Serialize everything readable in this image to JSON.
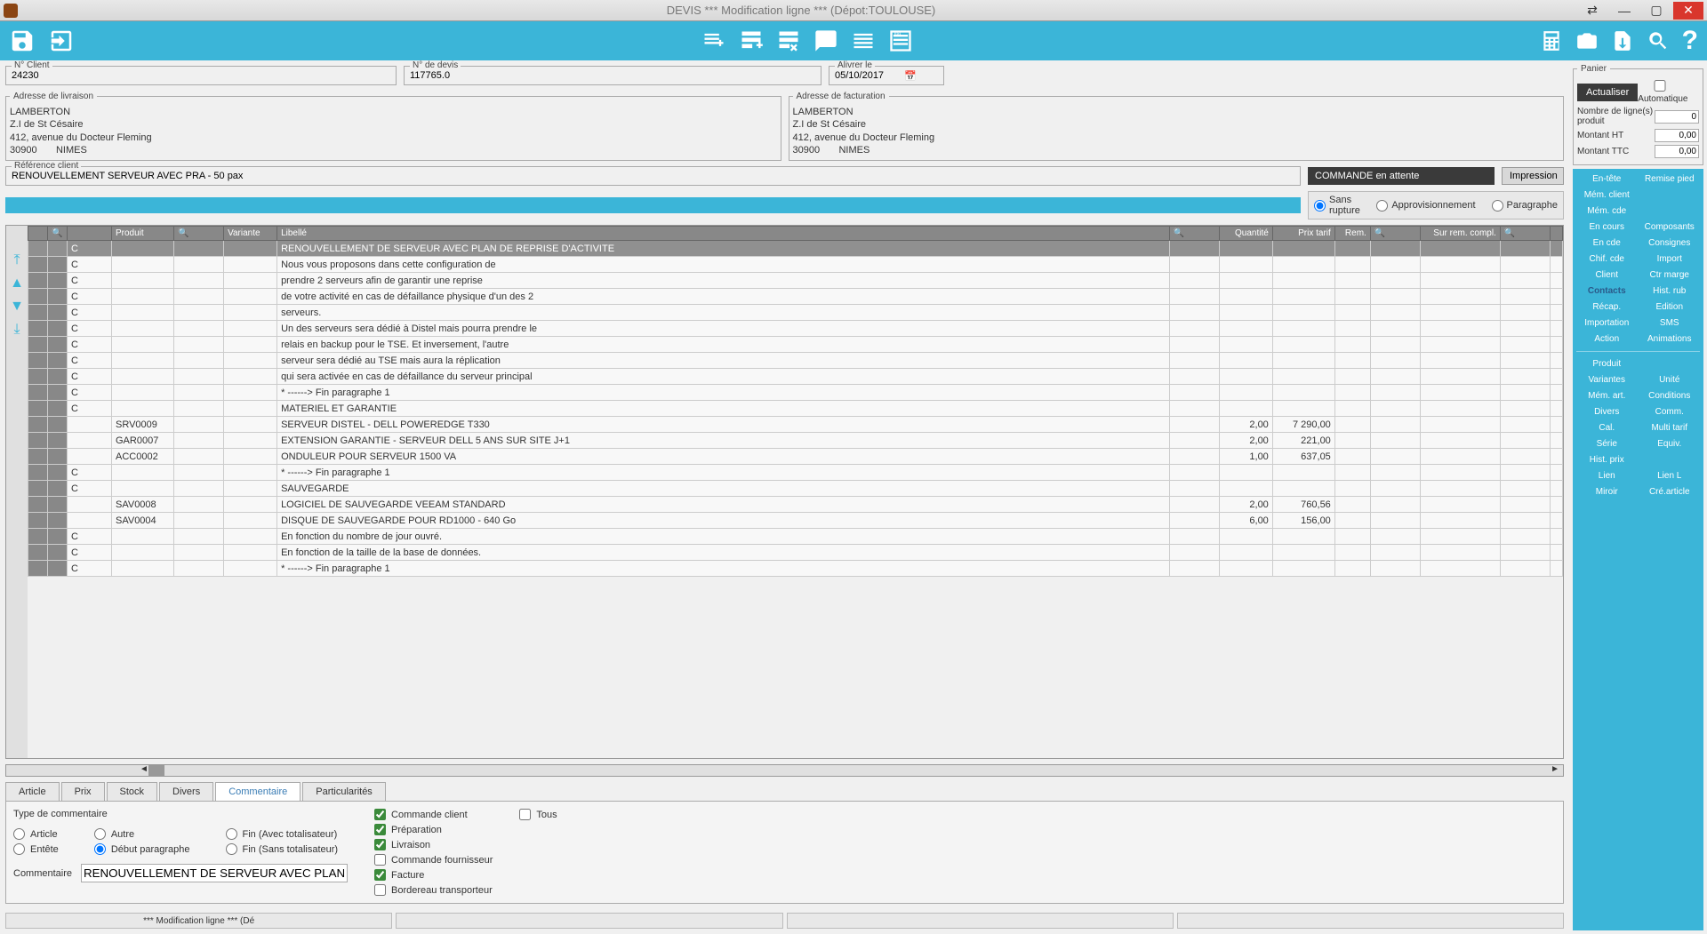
{
  "window": {
    "title": "DEVIS *** Modification ligne *** (Dépot:TOULOUSE)"
  },
  "toolbar": {},
  "fields": {
    "client_no_label": "N° Client",
    "client_no": "24230",
    "devis_no_label": "N° de devis",
    "devis_no": "117765.0",
    "alivrer_label": "Alivrer le",
    "alivrer": "05/10/2017",
    "ref_client_label": "Référence client",
    "ref_client": "RENOUVELLEMENT SERVEUR AVEC PRA - 50 pax"
  },
  "addr_livr": {
    "legend": "Adresse de livraison",
    "l1": "LAMBERTON",
    "l2": "Z.I de St Césaire",
    "l3": "412, avenue du Docteur Fleming",
    "l4": "30900       NIMES"
  },
  "addr_fact": {
    "legend": "Adresse de facturation",
    "l1": "LAMBERTON",
    "l2": "Z.I de St Césaire",
    "l3": "412, avenue du Docteur Fleming",
    "l4": "30900       NIMES"
  },
  "commande_attente": "COMMANDE en attente",
  "impression": "Impression",
  "rupture": {
    "sans": "Sans rupture",
    "appro": "Approvisionnement",
    "para": "Paragraphe"
  },
  "cols": {
    "produit": "Produit",
    "variante": "Variante",
    "libelle": "Libellé",
    "qte": "Quantité",
    "prix": "Prix tarif",
    "rem": "Rem.",
    "sur": "Sur rem. compl."
  },
  "rows": [
    {
      "t": "C",
      "p": "",
      "lib": "RENOUVELLEMENT DE SERVEUR AVEC PLAN DE REPRISE D'ACTIVITE",
      "q": "",
      "px": "",
      "hl": true
    },
    {
      "t": "C",
      "p": "",
      "lib": "Nous vous proposons dans cette configuration de",
      "q": "",
      "px": ""
    },
    {
      "t": "C",
      "p": "",
      "lib": "prendre 2 serveurs afin de garantir une reprise",
      "q": "",
      "px": ""
    },
    {
      "t": "C",
      "p": "",
      "lib": "de votre activité en cas de défaillance physique d'un des 2",
      "q": "",
      "px": ""
    },
    {
      "t": "C",
      "p": "",
      "lib": "serveurs.",
      "q": "",
      "px": ""
    },
    {
      "t": "C",
      "p": "",
      "lib": "Un des serveurs sera dédié à Distel mais pourra prendre le",
      "q": "",
      "px": ""
    },
    {
      "t": "C",
      "p": "",
      "lib": "relais en backup pour le TSE. Et inversement, l'autre",
      "q": "",
      "px": ""
    },
    {
      "t": "C",
      "p": "",
      "lib": "serveur sera dédié au TSE mais aura la réplication",
      "q": "",
      "px": ""
    },
    {
      "t": "C",
      "p": "",
      "lib": "qui sera activée en cas de défaillance du serveur principal",
      "q": "",
      "px": ""
    },
    {
      "t": "C",
      "p": "",
      "lib": "* ------> Fin paragraphe    1",
      "q": "",
      "px": ""
    },
    {
      "t": "C",
      "p": "",
      "lib": "MATERIEL ET GARANTIE",
      "q": "",
      "px": ""
    },
    {
      "t": "",
      "p": "SRV0009",
      "lib": "SERVEUR DISTEL - DELL POWEREDGE T330",
      "q": "2,00",
      "px": "7 290,00"
    },
    {
      "t": "",
      "p": "GAR0007",
      "lib": "EXTENSION GARANTIE - SERVEUR DELL 5 ANS SUR SITE J+1",
      "q": "2,00",
      "px": "221,00"
    },
    {
      "t": "",
      "p": "ACC0002",
      "lib": "ONDULEUR POUR SERVEUR 1500 VA",
      "q": "1,00",
      "px": "637,05"
    },
    {
      "t": "C",
      "p": "",
      "lib": "* ------> Fin paragraphe    1",
      "q": "",
      "px": ""
    },
    {
      "t": "C",
      "p": "",
      "lib": "SAUVEGARDE",
      "q": "",
      "px": ""
    },
    {
      "t": "",
      "p": "SAV0008",
      "lib": "LOGICIEL DE SAUVEGARDE VEEAM STANDARD",
      "q": "2,00",
      "px": "760,56"
    },
    {
      "t": "",
      "p": "SAV0004",
      "lib": "DISQUE DE SAUVEGARDE POUR RD1000 - 640 Go",
      "q": "6,00",
      "px": "156,00"
    },
    {
      "t": "C",
      "p": "",
      "lib": "En fonction du nombre de jour ouvré.",
      "q": "",
      "px": ""
    },
    {
      "t": "C",
      "p": "",
      "lib": "En fonction de la taille de la base de données.",
      "q": "",
      "px": ""
    },
    {
      "t": "C",
      "p": "",
      "lib": "* ------> Fin paragraphe    1",
      "q": "",
      "px": ""
    }
  ],
  "tabs": {
    "article": "Article",
    "prix": "Prix",
    "stock": "Stock",
    "divers": "Divers",
    "commentaire": "Commentaire",
    "partic": "Particularités"
  },
  "comment": {
    "type_label": "Type de commentaire",
    "article": "Article",
    "autre": "Autre",
    "fin_tot": "Fin (Avec totalisateur)",
    "entete": "Entête",
    "debut": "Début paragraphe",
    "fin_sans": "Fin (Sans totalisateur)",
    "commentaire_label": "Commentaire",
    "commentaire_val": "RENOUVELLEMENT DE SERVEUR AVEC PLAN DE REPRISE D'ACTIVITE",
    "cmd_client": "Commande client",
    "tous": "Tous",
    "prep": "Préparation",
    "livr": "Livraison",
    "cmd_fourn": "Commande fournisseur",
    "facture": "Facture",
    "bord": "Bordereau transporteur"
  },
  "status": "*** Modification ligne *** (Dé",
  "panier": {
    "legend": "Panier",
    "actualiser": "Actualiser",
    "auto": "Automatique",
    "nb_lignes": "Nombre de ligne(s) produit",
    "nb_val": "0",
    "ht": "Montant HT",
    "ht_val": "0,00",
    "ttc": "Montant TTC",
    "ttc_val": "0,00"
  },
  "menu": {
    "entete": "En-tête",
    "remise": "Remise pied",
    "mem_client": "Mém. client",
    "mem_cde": "Mém. cde",
    "encours": "En cours",
    "composants": "Composants",
    "encde": "En cde",
    "consignes": "Consignes",
    "chif": "Chif. cde",
    "import": "Import",
    "client": "Client",
    "ctr": "Ctr marge",
    "contacts": "Contacts",
    "histrub": "Hist. rub",
    "recap": "Récap.",
    "edition": "Edition",
    "importation": "Importation",
    "sms": "SMS",
    "action": "Action",
    "anim": "Animations",
    "produit": "Produit",
    "variantes": "Variantes",
    "unite": "Unité",
    "memart": "Mém. art.",
    "cond": "Conditions",
    "divers": "Divers",
    "comm": "Comm.",
    "cal": "Cal.",
    "multi": "Multi tarif",
    "serie": "Série",
    "equiv": "Equiv.",
    "histprix": "Hist. prix",
    "lien": "Lien",
    "lienl": "Lien L",
    "miroir": "Miroir",
    "creart": "Cré.article"
  }
}
